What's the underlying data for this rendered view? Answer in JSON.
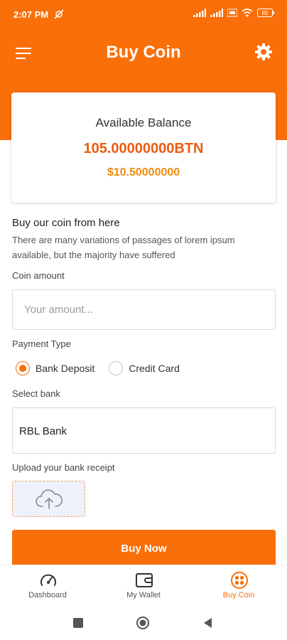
{
  "status_bar": {
    "time": "2:07 PM",
    "battery": "85"
  },
  "header": {
    "title": "Buy Coin",
    "menu_icon": "hamburger-menu-icon",
    "settings_icon": "gear-icon"
  },
  "balance": {
    "label": "Available Balance",
    "coin_amount": "105.00000000BTN",
    "usd_amount": "$10.50000000"
  },
  "intro": {
    "title": "Buy our coin from here",
    "description": "There are many variations of passages of lorem ipsum available, but the majority have suffered"
  },
  "form": {
    "coin_amount_label": "Coin amount",
    "coin_amount_placeholder": "Your amount...",
    "coin_amount_value": "",
    "payment_type_label": "Payment Type",
    "payment_options": [
      {
        "label": "Bank Deposit",
        "selected": true
      },
      {
        "label": "Credit Card",
        "selected": false
      }
    ],
    "select_bank_label": "Select bank",
    "selected_bank": "RBL Bank",
    "upload_label": "Upload your bank receipt",
    "upload_icon": "cloud-upload-icon",
    "submit_label": "Buy Now"
  },
  "bottom_nav": {
    "items": [
      {
        "label": "Dashboard",
        "icon": "speedometer-icon",
        "active": false
      },
      {
        "label": "My Wallet",
        "icon": "wallet-icon",
        "active": false
      },
      {
        "label": "Buy Coin",
        "icon": "coin-grid-icon",
        "active": true
      }
    ]
  },
  "colors": {
    "primary": "#f96f0a",
    "balance_btn": "#ea5c10",
    "balance_usd": "#f08c12"
  }
}
